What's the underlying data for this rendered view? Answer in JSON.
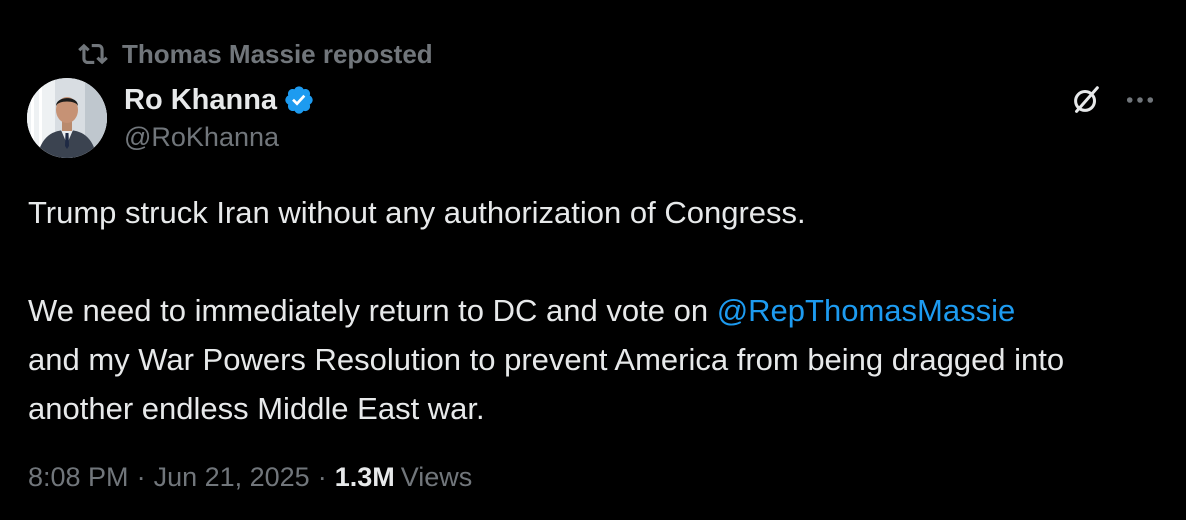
{
  "repost": {
    "icon": "repost-icon",
    "text": "Thomas Massie reposted"
  },
  "author": {
    "display_name": "Ro Khanna",
    "handle": "@RoKhanna",
    "verified_icon": "verified-badge-icon",
    "verified_color": "#1d9bf0",
    "avatar": "author-avatar"
  },
  "actions": {
    "grok_icon": "grok-icon",
    "more_icon": "more-options-icon"
  },
  "tweet": {
    "line1": "Trump struck Iran without any authorization of Congress.",
    "line2_prefix": "We need to immediately return to DC and vote on ",
    "mention": "@RepThomasMassie",
    "line2_suffix": "and my War Powers Resolution to prevent America from being dragged into another endless Middle East war."
  },
  "meta": {
    "time": "8:08 PM",
    "separator": "·",
    "date": "Jun 21, 2025",
    "views_count": "1.3M",
    "views_label": "Views"
  },
  "colors": {
    "background": "#000000",
    "primary_text": "#e7e9ea",
    "secondary_text": "#71767b",
    "accent": "#1d9bf0"
  }
}
